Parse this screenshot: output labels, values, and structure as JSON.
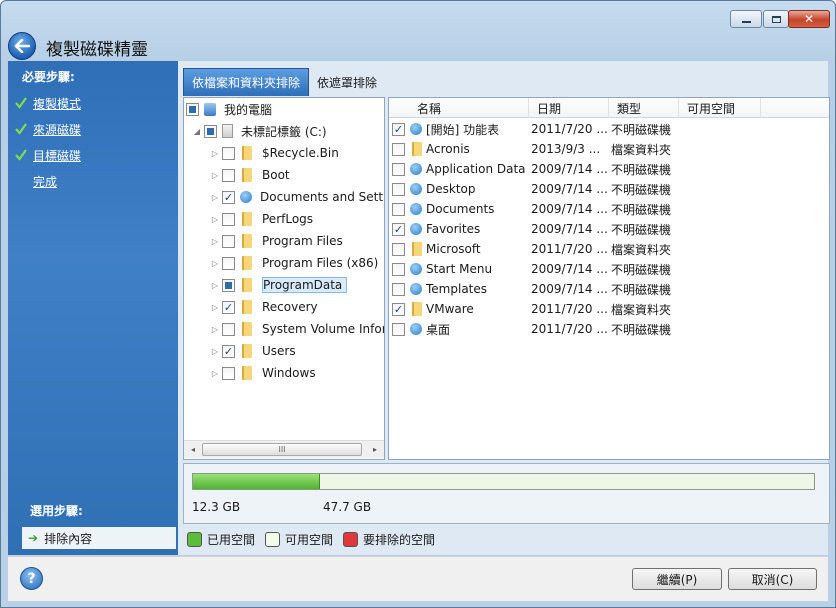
{
  "window": {
    "title": "複製磁碟精靈"
  },
  "sidebar": {
    "required_header": "必要步驟:",
    "steps": [
      {
        "label": "複製模式",
        "done": true
      },
      {
        "label": "來源磁碟",
        "done": true
      },
      {
        "label": "目標磁碟",
        "done": true
      },
      {
        "label": "完成",
        "done": false
      }
    ],
    "optional_header": "選用步驟:",
    "optional_steps": [
      {
        "label": "排除內容",
        "active": true
      }
    ]
  },
  "tabs": [
    {
      "label": "依檔案和資料夾排除",
      "active": true
    },
    {
      "label": "依遮罩排除",
      "active": false
    }
  ],
  "tree": {
    "root": {
      "label": "我的電腦"
    },
    "drive": {
      "label": "未標記標籤 (C:)"
    },
    "items": [
      {
        "label": "$Recycle.Bin",
        "checked": "none",
        "icon": "folder"
      },
      {
        "label": "Boot",
        "checked": "none",
        "icon": "folder"
      },
      {
        "label": "Documents and Settin",
        "checked": "checked",
        "icon": "system-folder"
      },
      {
        "label": "PerfLogs",
        "checked": "none",
        "icon": "folder"
      },
      {
        "label": "Program Files",
        "checked": "none",
        "icon": "folder"
      },
      {
        "label": "Program Files (x86)",
        "checked": "none",
        "icon": "folder"
      },
      {
        "label": "ProgramData",
        "checked": "partial",
        "icon": "folder",
        "selected": true
      },
      {
        "label": "Recovery",
        "checked": "checked",
        "icon": "folder"
      },
      {
        "label": "System Volume Inforr",
        "checked": "none",
        "icon": "folder"
      },
      {
        "label": "Users",
        "checked": "checked",
        "icon": "folder"
      },
      {
        "label": "Windows",
        "checked": "none",
        "icon": "folder"
      }
    ],
    "scroll_thumb": "III"
  },
  "list": {
    "columns": [
      "名稱",
      "日期",
      "類型",
      "可用空間"
    ],
    "rows": [
      {
        "name": "[開始] 功能表",
        "date": "2011/7/20 ...",
        "type": "不明磁碟機",
        "checked": true,
        "icon": "system-folder"
      },
      {
        "name": "Acronis",
        "date": "2013/9/3 ...",
        "type": "檔案資料夾",
        "checked": false,
        "icon": "folder"
      },
      {
        "name": "Application Data",
        "date": "2009/7/14 ...",
        "type": "不明磁碟機",
        "checked": false,
        "icon": "system-folder"
      },
      {
        "name": "Desktop",
        "date": "2009/7/14 ...",
        "type": "不明磁碟機",
        "checked": false,
        "icon": "system-folder"
      },
      {
        "name": "Documents",
        "date": "2009/7/14 ...",
        "type": "不明磁碟機",
        "checked": false,
        "icon": "system-folder"
      },
      {
        "name": "Favorites",
        "date": "2009/7/14 ...",
        "type": "不明磁碟機",
        "checked": true,
        "icon": "system-folder"
      },
      {
        "name": "Microsoft",
        "date": "2011/7/20 ...",
        "type": "檔案資料夾",
        "checked": false,
        "icon": "folder"
      },
      {
        "name": "Start Menu",
        "date": "2009/7/14 ...",
        "type": "不明磁碟機",
        "checked": false,
        "icon": "system-folder"
      },
      {
        "name": "Templates",
        "date": "2009/7/14 ...",
        "type": "不明磁碟機",
        "checked": false,
        "icon": "system-folder"
      },
      {
        "name": "VMware",
        "date": "2011/7/20 ...",
        "type": "檔案資料夾",
        "checked": true,
        "icon": "folder"
      },
      {
        "name": "桌面",
        "date": "2011/7/20 ...",
        "type": "不明磁碟機",
        "checked": false,
        "icon": "system-folder"
      }
    ]
  },
  "space": {
    "used_label": "12.3 GB",
    "free_label": "47.7 GB",
    "used_fraction": 0.205
  },
  "legend": [
    {
      "label": "已用空間",
      "color": "#5cbd3b"
    },
    {
      "label": "可用空間",
      "color": "#f2fbe8"
    },
    {
      "label": "要排除的空間",
      "color": "#e0383a"
    }
  ],
  "footer": {
    "next_label": "繼續(P)",
    "cancel_label": "取消(C)"
  }
}
